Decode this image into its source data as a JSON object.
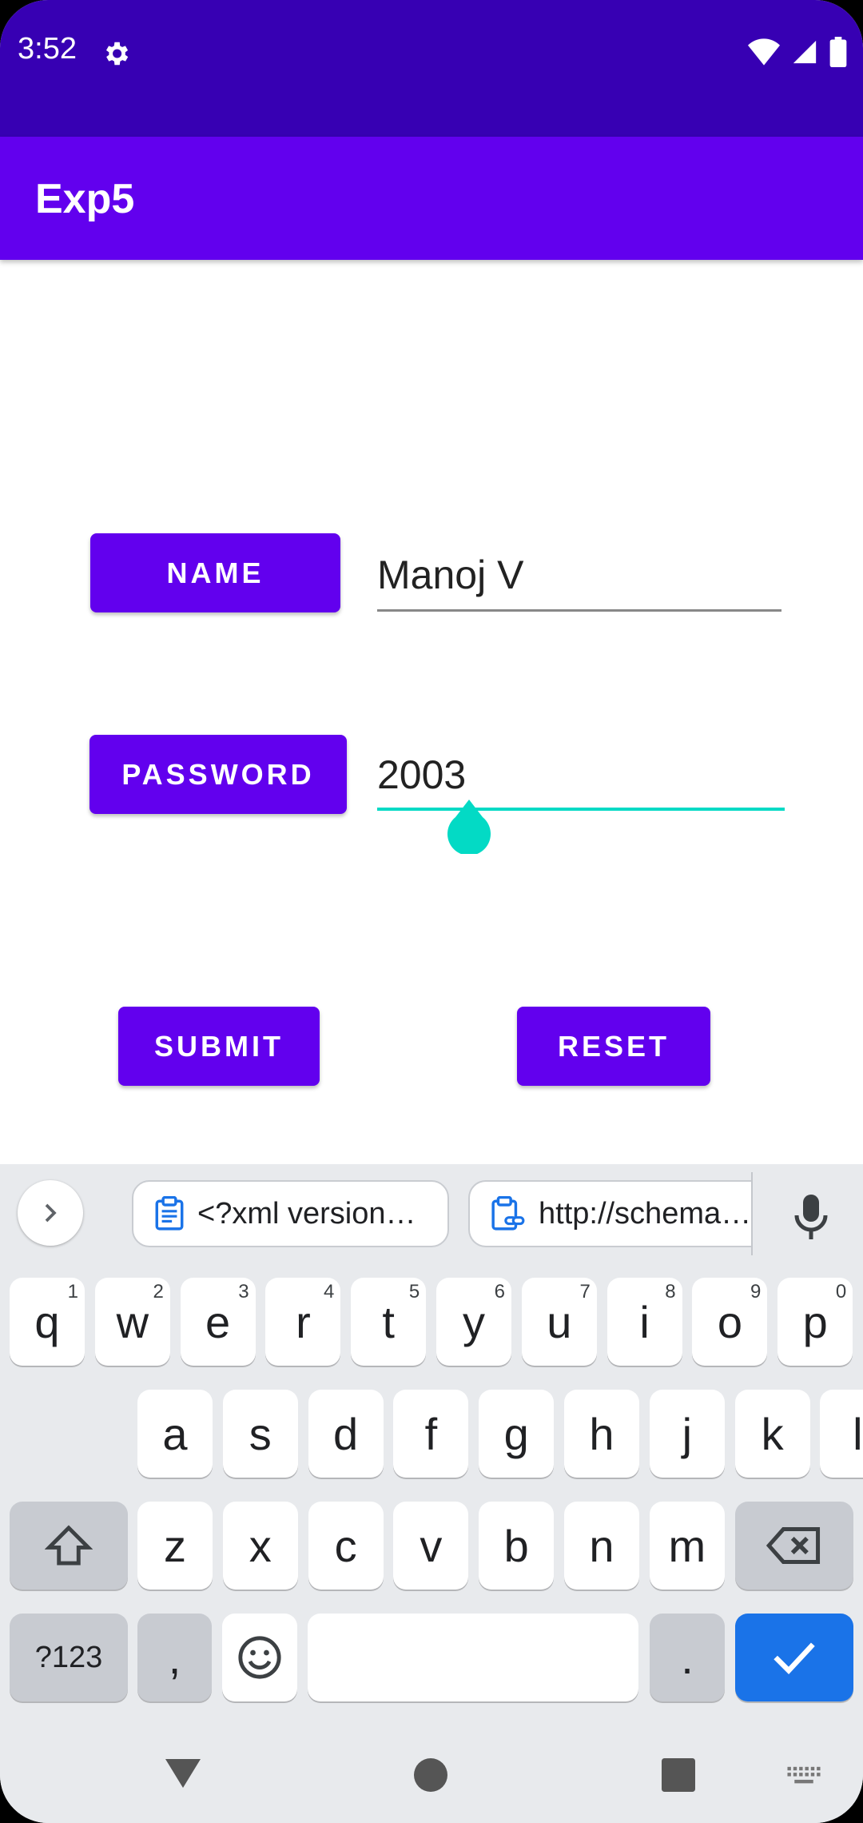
{
  "status": {
    "time": "3:52"
  },
  "app": {
    "title": "Exp5"
  },
  "form": {
    "name_label": "NAME",
    "name_value": "Manoj V",
    "password_label": "PASSWORD",
    "password_value": "2003",
    "submit_label": "SUBMIT",
    "reset_label": "RESET"
  },
  "keyboard": {
    "clipboard_chip_1": "<?xml version…",
    "clipboard_chip_2": "http://schema…",
    "row1": [
      {
        "k": "q",
        "h": "1"
      },
      {
        "k": "w",
        "h": "2"
      },
      {
        "k": "e",
        "h": "3"
      },
      {
        "k": "r",
        "h": "4"
      },
      {
        "k": "t",
        "h": "5"
      },
      {
        "k": "y",
        "h": "6"
      },
      {
        "k": "u",
        "h": "7"
      },
      {
        "k": "i",
        "h": "8"
      },
      {
        "k": "o",
        "h": "9"
      },
      {
        "k": "p",
        "h": "0"
      }
    ],
    "row2": [
      "a",
      "s",
      "d",
      "f",
      "g",
      "h",
      "j",
      "k",
      "l"
    ],
    "row3": [
      "z",
      "x",
      "c",
      "v",
      "b",
      "n",
      "m"
    ],
    "symbols_label": "?123",
    "comma_label": ",",
    "period_label": "."
  },
  "colors": {
    "status_bar": "#3700b3",
    "app_bar": "#6200ee",
    "accent": "#03dac5",
    "enter_key": "#1a73e8"
  }
}
